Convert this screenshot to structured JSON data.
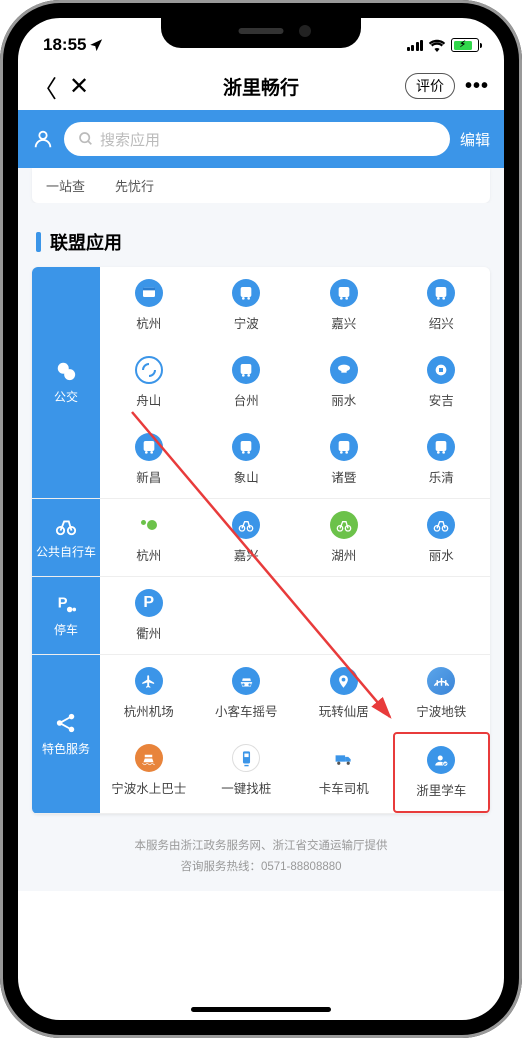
{
  "status_bar": {
    "time": "18:55"
  },
  "nav": {
    "title": "浙里畅行",
    "eval": "评价"
  },
  "search": {
    "placeholder": "搜索应用",
    "edit": "编辑"
  },
  "lingering_tags": {
    "t0": "一站查",
    "t1": "先忧行"
  },
  "section": {
    "title": "联盟应用"
  },
  "cat_bus": "公交",
  "bus": {
    "i0": "杭州",
    "i1": "宁波",
    "i2": "嘉兴",
    "i3": "绍兴",
    "i4": "舟山",
    "i5": "台州",
    "i6": "丽水",
    "i7": "安吉",
    "i8": "新昌",
    "i9": "象山",
    "i10": "诸暨",
    "i11": "乐清"
  },
  "cat_bike": "公共自行车",
  "bike": {
    "i0": "杭州",
    "i1": "嘉兴",
    "i2": "湖州",
    "i3": "丽水"
  },
  "cat_park": "停车",
  "park": {
    "i0": "衢州"
  },
  "cat_special": "特色服务",
  "special": {
    "i0": "杭州机场",
    "i1": "小客车摇号",
    "i2": "玩转仙居",
    "i3": "宁波地铁",
    "i4": "宁波水上巴士",
    "i5": "一键找桩",
    "i6": "卡车司机",
    "i7": "浙里学车"
  },
  "footer": {
    "l1": "本服务由浙江政务服务网、浙江省交通运输厅提供",
    "l2": "咨询服务热线：0571-88808880"
  }
}
